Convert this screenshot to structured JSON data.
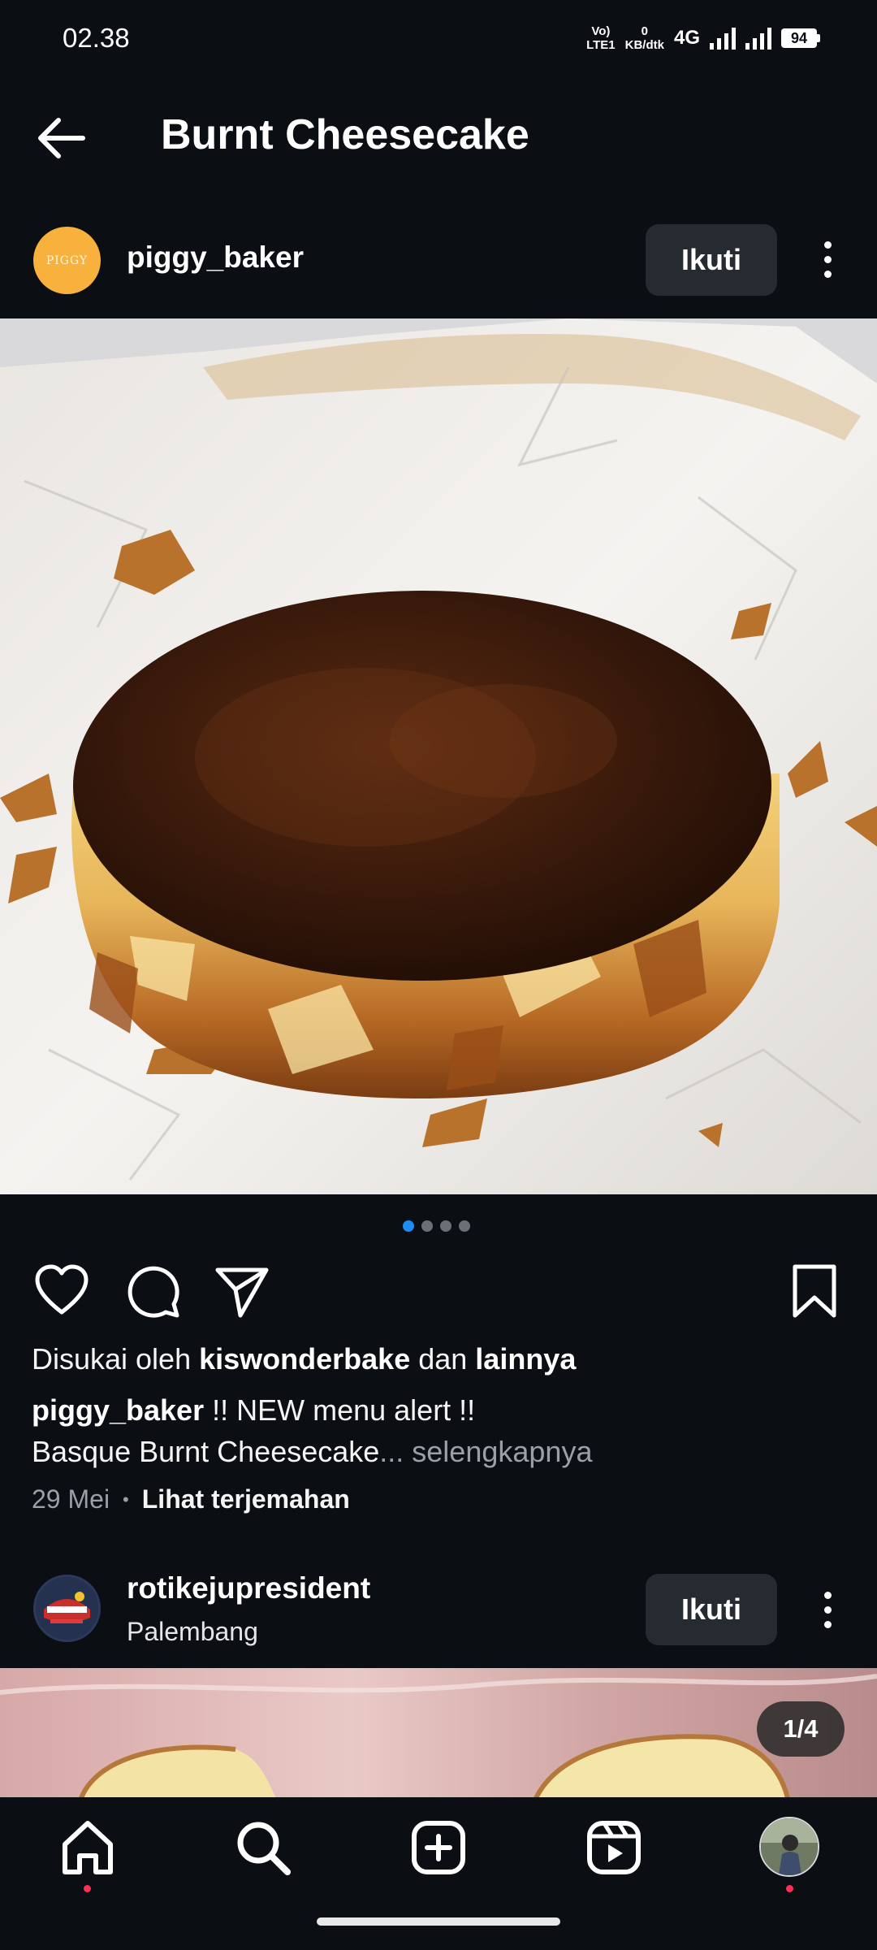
{
  "status_bar": {
    "time": "02.38",
    "volte_top": "Vo)",
    "volte_bottom": "LTE1",
    "speed_value": "0",
    "speed_unit": "KB/dtk",
    "network": "4G",
    "battery": "94"
  },
  "header": {
    "title": "Burnt Cheesecake",
    "back_icon": "arrow-left-icon"
  },
  "post": {
    "avatar_text": "PIGGY",
    "username": "piggy_baker",
    "follow_label": "Ikuti",
    "carousel": {
      "count": 4,
      "active_index": 0
    },
    "likes_prefix": "Disukai oleh ",
    "likes_user": "kiswonderbake",
    "likes_middle": " dan ",
    "likes_suffix": "lainnya",
    "caption_user": "piggy_baker",
    "caption_text": " !! NEW menu alert !!",
    "caption_line2": "Basque Burnt Cheesecake",
    "caption_more": "... selengkapnya",
    "date": "29 Mei",
    "separator": "•",
    "translate_label": "Lihat terjemahan"
  },
  "post2": {
    "username": "rotikejupresident",
    "location": "Palembang",
    "follow_label": "Ikuti",
    "counter": "1/4"
  },
  "nav": {
    "items": [
      "home-icon",
      "search-icon",
      "create-icon",
      "reels-icon",
      "profile-avatar"
    ]
  },
  "colors": {
    "background": "#0b0f14",
    "button": "#262a31",
    "accent_blue": "#1d8df5",
    "notification_red": "#ff2e55"
  }
}
